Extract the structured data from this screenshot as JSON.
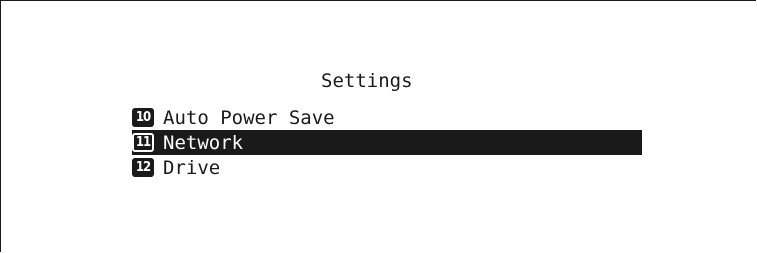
{
  "screen": {
    "title": "Settings"
  },
  "menu": {
    "items": [
      {
        "number": "10",
        "label": "Auto Power Save",
        "selected": false
      },
      {
        "number": "11",
        "label": "Network",
        "selected": true
      },
      {
        "number": "12",
        "label": "Drive",
        "selected": false
      }
    ]
  },
  "colors": {
    "foreground": "#1a1a1a",
    "background": "#ffffff",
    "highlight": "#1a1a1a",
    "highlight_text": "#ffffff"
  }
}
